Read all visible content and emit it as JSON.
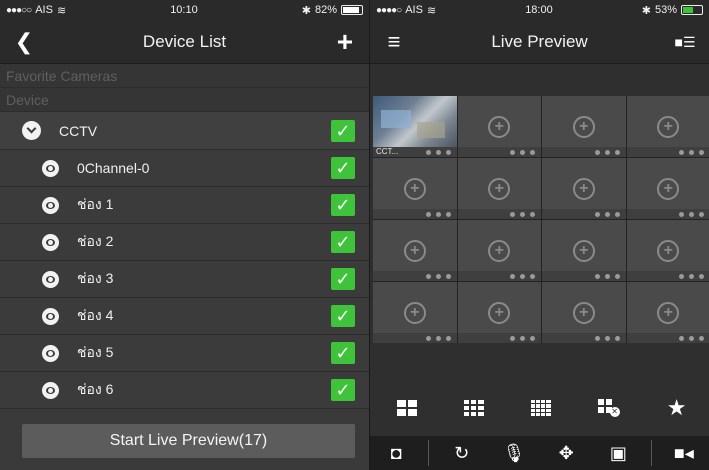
{
  "left": {
    "status": {
      "carrier": "AIS",
      "time": "10:10",
      "battery": "82%",
      "battery_level": 0.82
    },
    "nav": {
      "title": "Device List",
      "back_icon": "back-chevron-icon",
      "add_icon": "plus-icon"
    },
    "sections": {
      "favorites": "Favorite Cameras",
      "device": "Device"
    },
    "root": {
      "label": "CCTV",
      "checked": true
    },
    "channels": [
      {
        "label": "0Channel-0",
        "checked": true
      },
      {
        "label": "ช่อง 1",
        "checked": true
      },
      {
        "label": "ช่อง 2",
        "checked": true
      },
      {
        "label": "ช่อง 3",
        "checked": true
      },
      {
        "label": "ช่อง 4",
        "checked": true
      },
      {
        "label": "ช่อง 5",
        "checked": true
      },
      {
        "label": "ช่อง 6",
        "checked": true
      }
    ],
    "start_button": "Start Live Preview(17)"
  },
  "right": {
    "status": {
      "carrier": "AIS",
      "time": "18:00",
      "battery": "53%",
      "battery_level": 0.53
    },
    "nav": {
      "title": "Live Preview",
      "menu_icon": "hamburger-icon",
      "side_icon": "side-panel-icon"
    },
    "active_camera_label": "CCT...",
    "grid_cells": 16,
    "layouts": [
      "layout-4-icon",
      "layout-9-icon",
      "layout-16-icon",
      "close-all-icon",
      "favorite-star-icon"
    ],
    "tools": [
      "camera-icon",
      "ptz-rotate-icon",
      "microphone-icon",
      "direction-icon",
      "screen-icon",
      "record-icon"
    ]
  },
  "colors": {
    "accent_green": "#3ec33a",
    "nav_bg": "#2a2a2a",
    "cell_bg": "#4a4a4a"
  }
}
